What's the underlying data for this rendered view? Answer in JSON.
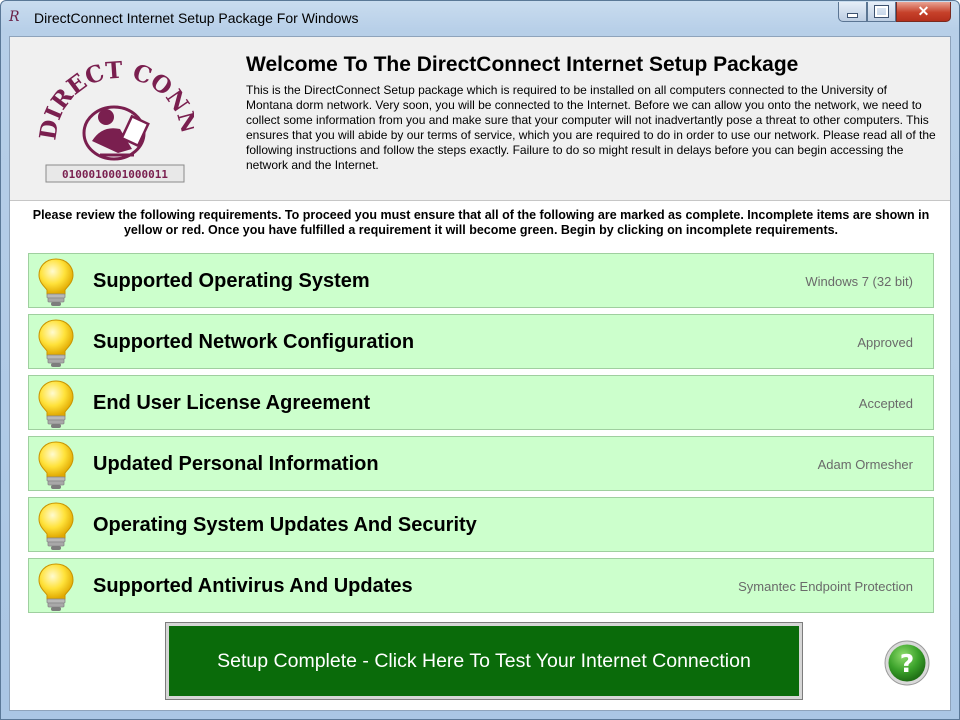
{
  "window": {
    "title": "DirectConnect Internet Setup Package For Windows",
    "app_icon_glyph": "R",
    "close_glyph": "✕"
  },
  "header": {
    "welcome_title": "Welcome To The DirectConnect Internet Setup Package",
    "intro_text": "This is the DirectConnect Setup package which is required to be installed on all computers connected to the University of Montana dorm network.  Very soon, you will be connected to the Internet.  Before we can allow you onto the network, we need to collect some information from you and make sure that your computer will not inadvertantly pose a threat to other computers.  This ensures that you will abide by our terms of service, which you are required to do in order to use our network.  Please read all of the following instructions and follow the steps exactly.  Failure to do so might result in delays before you can begin accessing the network and the Internet."
  },
  "logo": {
    "text_top": "DIRECT CONNECT",
    "binary": "0100010001000011",
    "color": "#7a1f4f"
  },
  "requirements_note": "Please review the following requirements.  To proceed you must ensure that all of the following are marked as complete.  Incomplete items are shown in yellow or red.  Once you have fulfilled a requirement it will become green.  Begin by clicking on incomplete requirements.",
  "requirements": [
    {
      "label": "Supported Operating System",
      "status": "Windows 7 (32 bit)",
      "icon": "lightbulb-icon",
      "state_color": "#ccffcc"
    },
    {
      "label": "Supported Network Configuration",
      "status": "Approved",
      "icon": "lightbulb-icon",
      "state_color": "#ccffcc"
    },
    {
      "label": "End User License Agreement",
      "status": "Accepted",
      "icon": "lightbulb-icon",
      "state_color": "#ccffcc"
    },
    {
      "label": "Updated Personal Information",
      "status": "Adam Ormesher",
      "icon": "lightbulb-icon",
      "state_color": "#ccffcc"
    },
    {
      "label": "Operating System Updates And Security",
      "status": "",
      "icon": "lightbulb-icon",
      "state_color": "#ccffcc"
    },
    {
      "label": "Supported Antivirus And Updates",
      "status": "Symantec Endpoint Protection",
      "icon": "lightbulb-icon",
      "state_color": "#ccffcc"
    }
  ],
  "test_button_label": "Setup Complete - Click Here To Test Your Internet Connection",
  "help_button": {
    "glyph": "?",
    "color": "#3aa12a",
    "icon": "help-icon"
  }
}
